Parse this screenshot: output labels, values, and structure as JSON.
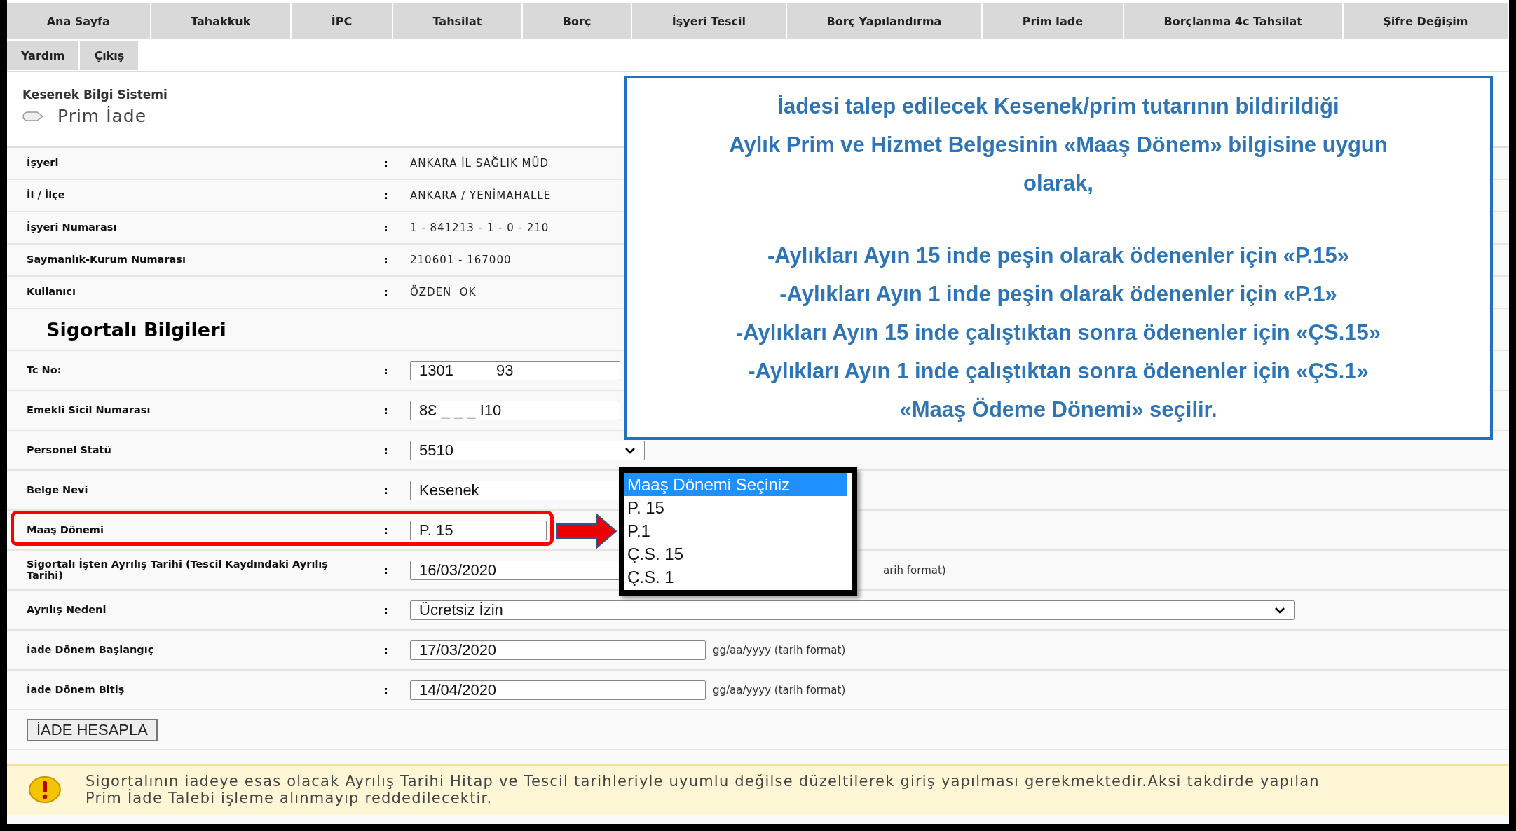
{
  "tab_rows": [
    {
      "tabs": [
        "Ana Sayfa",
        "Tahakkuk",
        "İPC",
        "Tahsilat",
        "Borç",
        "İşyeri Tescil",
        "Borç Yapılandırma",
        "Prim Iade",
        "Borçlanma 4c Tahsilat",
        "Şifre Değişim"
      ]
    },
    {
      "tabs": [
        "Yardım",
        "Çıkış"
      ]
    }
  ],
  "header": {
    "system": "Kesenek Bilgi Sistemi",
    "page_title": "Prim İade"
  },
  "info_rows": [
    {
      "label": "İşyeri",
      "value": "ANKARA İL SAĞLIK MÜD"
    },
    {
      "label": "İl / İlçe",
      "value": "ANKARA / YENİMAHALLE"
    },
    {
      "label": "İşyeri Numarası",
      "value": "1 - 841213 - 1 - 0 - 210"
    },
    {
      "label": "Saymanlık-Kurum Numarası",
      "value": "210601 - 167000"
    },
    {
      "label": "Kullanıcı",
      "value": "ÖZDEN  OK"
    }
  ],
  "section_title": "Sigortalı Bilgileri",
  "colon": ":",
  "form_rows": [
    {
      "label": "Tc No:",
      "kind": "input",
      "value": "1301          93"
    },
    {
      "label": "Emekli Sicil Numarası",
      "kind": "input",
      "value": "8Ɛ _ _ _ I10"
    },
    {
      "label": "Personel Statü",
      "kind": "select",
      "value": "5510"
    },
    {
      "label": "Belge Nevi",
      "kind": "input",
      "value": "Kesenek"
    },
    {
      "label": "Maaş Dönemi",
      "kind": "input",
      "value": "P. 15",
      "highlighted": true
    },
    {
      "label": "Sigortalı İşten Ayrılış Tarihi (Tescil Kaydındaki Ayrılış Tarihi)",
      "kind": "covered",
      "value": "16/03/2020",
      "hint": "arih format)"
    },
    {
      "label": "Ayrılış Nedeni",
      "kind": "select",
      "value": "Ücretsiz İzin"
    },
    {
      "label": "İade Dönem Başlangıç",
      "kind": "date",
      "value": "17/03/2020",
      "hint": "gg/aa/yyyy (tarih format)"
    },
    {
      "label": "İade Dönem Bitiş",
      "kind": "date",
      "value": "14/04/2020",
      "hint": "gg/aa/yyyy (tarih format)"
    }
  ],
  "dropdown": {
    "options": [
      {
        "label": "Maaş Dönemi Seçiniz",
        "selected": true
      },
      {
        "label": "P. 15",
        "selected": false
      },
      {
        "label": "P.1",
        "selected": false
      },
      {
        "label": "Ç.S. 15",
        "selected": false
      },
      {
        "label": "Ç.S. 1",
        "selected": false
      }
    ]
  },
  "button": "İADE HESAPLA",
  "warning": "Sigortalının iadeye esas olacak Ayrılış Tarihi Hitap ve Tescil tarihleriyle uyumlu değilse düzeltilerek giriş yapılması gerekmektedir.Aksi takdirde yapılan Prim İade Talebi işleme alınmayıp reddedilecektir.",
  "callout": {
    "intro_lines": [
      "İadesi talep edilecek Kesenek/prim tutarının bildirildiği",
      "Aylık Prim ve Hizmet Belgesinin «Maaş Dönem» bilgisine uygun",
      "olarak,"
    ],
    "items": [
      "-Aylıkları Ayın 15 inde peşin olarak ödenenler için «P.15»",
      "-Aylıkları Ayın 1 inde peşin olarak ödenenler için «P.1»",
      "-Aylıkları Ayın 15 inde çalıştıktan sonra ödenenler için «ÇS.15»",
      "-Aylıkları Ayın 1 inde çalıştıktan sonra ödenenler için «ÇS.1»"
    ],
    "closing": "«Maaş Ödeme Dönemi» seçilir."
  }
}
